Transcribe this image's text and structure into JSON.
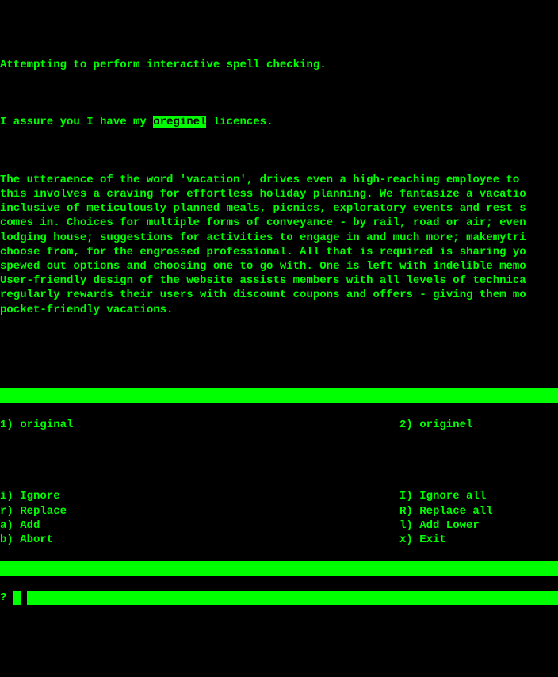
{
  "header": "Attempting to perform interactive spell checking.",
  "sentence": {
    "before": "I assure you I have my ",
    "misspelled": "oreginel",
    "after": " licences."
  },
  "paragraph": "The utteraence of the word 'vacation', drives even a high-reaching employee to\nthis involves a craving for effortless holiday planning. We fantasize a vacatio\ninclusive of meticulously planned meals, picnics, exploratory events and rest s\ncomes in. Choices for multiple forms of conveyance - by rail, road or air; even\nlodging house; suggestions for activities to engage in and much more; makemytri\nchoose from, for the engrossed professional. All that is required is sharing yo\nspewed out options and choosing one to go with. One is left with indelible memo\nUser-friendly design of the website assists members with all levels of technica\nregularly rewards their users with discount coupons and offers - giving them mo\npocket-friendly vacations.",
  "suggestions": {
    "s1": "1) original",
    "s2": "2) originel"
  },
  "actions": {
    "ignore": "i) Ignore",
    "ignore_all": "I) Ignore all",
    "replace": "r) Replace",
    "replace_all": "R) Replace all",
    "add": "a) Add",
    "add_lower": "l) Add Lower",
    "abort": "b) Abort",
    "exit": "x) Exit"
  },
  "prompt": "? "
}
